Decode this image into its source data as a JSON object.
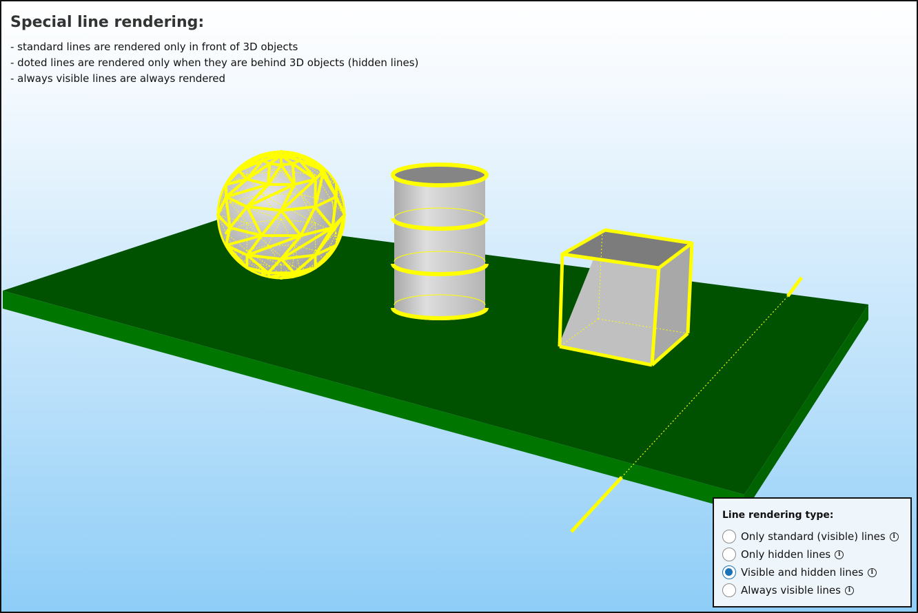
{
  "header": {
    "title": "Special line rendering:",
    "lines": [
      "- standard lines are rendered only in front of 3D objects",
      "- doted lines are rendered only when they are behind 3D objects (hidden lines)",
      "- always visible lines are always rendered"
    ]
  },
  "scene": {
    "objects": [
      "sphere-wireframe",
      "cylinder",
      "box",
      "line"
    ],
    "colors": {
      "line": "#ffff00",
      "plane_top": "#005000",
      "plane_side": "#007000",
      "object": "#c0c0c0"
    }
  },
  "panel": {
    "title": "Line rendering type:",
    "options": [
      {
        "label": "Only standard (visible) lines",
        "checked": false,
        "icon": "info-icon"
      },
      {
        "label": "Only hidden lines",
        "checked": false,
        "icon": "info-icon"
      },
      {
        "label": "Visible and hidden lines",
        "checked": true,
        "icon": "info-icon"
      },
      {
        "label": "Always visible lines",
        "checked": false,
        "icon": "info-icon"
      }
    ]
  }
}
